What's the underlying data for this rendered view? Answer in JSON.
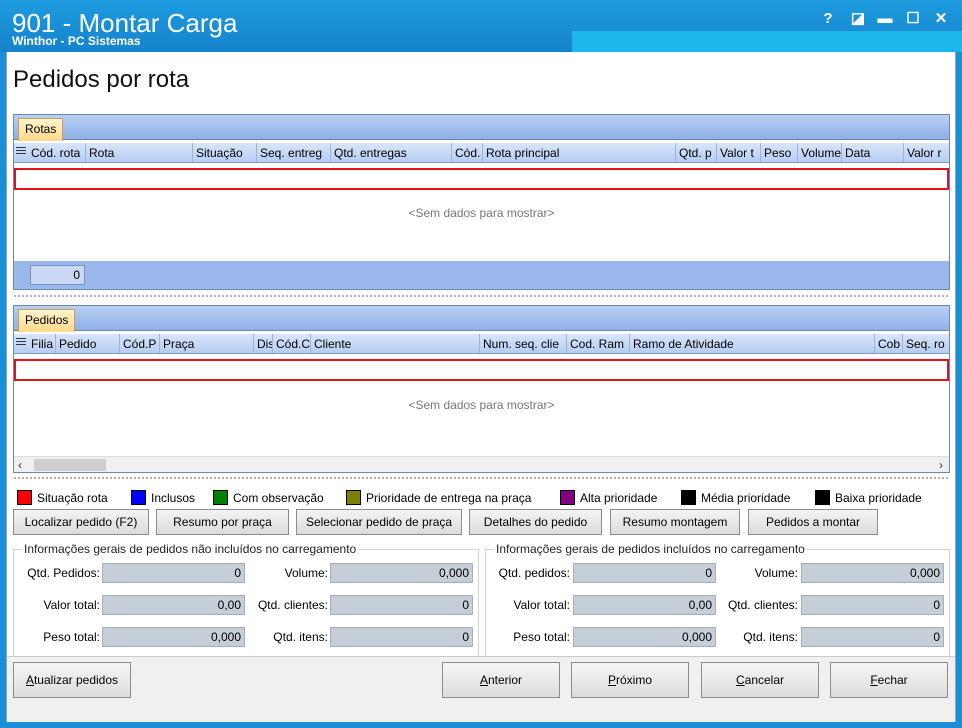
{
  "window": {
    "title": "901 - Montar Carga",
    "subtitle": "Winthor - PC Sistemas",
    "help": "?",
    "restore": "◪",
    "minimize": "▬",
    "maximize": "☐",
    "close": "✕"
  },
  "page": {
    "title": "Pedidos por rota"
  },
  "rotas": {
    "tab": "Rotas",
    "columns": [
      "Cód. rota",
      "Rota",
      "Situação",
      "Seq. entreg",
      "Qtd. entregas",
      "Cód.",
      "Rota principal",
      "Qtd. p",
      "Valor t",
      "Peso",
      "Volume",
      "Data",
      "Valor r"
    ],
    "empty": "<Sem dados para mostrar>",
    "footer_count": "0"
  },
  "pedidos": {
    "tab": "Pedidos",
    "columns": [
      "Filia",
      "Pedido",
      "Cód.P",
      "Praça",
      "Dis",
      "Cód.C",
      "Cliente",
      "Num. seq. clie",
      "Cod. Ram",
      "Ramo de Atividade",
      "Cob",
      "Seq. ro"
    ],
    "empty": "<Sem dados para mostrar>"
  },
  "legend": [
    {
      "label": "Situação rota",
      "color": "#ff0000"
    },
    {
      "label": "Inclusos",
      "color": "#0000ff"
    },
    {
      "label": "Com observação",
      "color": "#008000"
    },
    {
      "label": "Prioridade de entrega na praça",
      "color": "#808000"
    },
    {
      "label": "Alta prioridade",
      "color": "#800080"
    },
    {
      "label": "Média prioridade",
      "color": "#000000"
    },
    {
      "label": "Baixa prioridade",
      "color": "#000000"
    }
  ],
  "actions": {
    "localizar": "Localizar pedido (F2)",
    "resumo_praca": "Resumo por praça",
    "selecionar_praca": "Selecionar pedido de praça",
    "detalhes": "Detalhes do pedido",
    "resumo_montagem": "Resumo montagem",
    "pedidos_montar": "Pedidos a montar"
  },
  "nao_incluidos": {
    "title": "Informações gerais de pedidos não incluídos no carregamento",
    "qtd_pedidos_label": "Qtd. Pedidos:",
    "qtd_pedidos": "0",
    "valor_total_label": "Valor total:",
    "valor_total": "0,00",
    "peso_total_label": "Peso total:",
    "peso_total": "0,000",
    "volume_label": "Volume:",
    "volume": "0,000",
    "qtd_clientes_label": "Qtd. clientes:",
    "qtd_clientes": "0",
    "qtd_itens_label": "Qtd. itens:",
    "qtd_itens": "0"
  },
  "incluidos": {
    "title": "Informações gerais de pedidos incluídos no carregamento",
    "qtd_pedidos_label": "Qtd. pedidos:",
    "qtd_pedidos": "0",
    "valor_total_label": "Valor total:",
    "valor_total": "0,00",
    "peso_total_label": "Peso total:",
    "peso_total": "0,000",
    "volume_label": "Volume:",
    "volume": "0,000",
    "qtd_clientes_label": "Qtd. clientes:",
    "qtd_clientes": "0",
    "qtd_itens_label": "Qtd. itens:",
    "qtd_itens": "0"
  },
  "footer": {
    "atualizar": "Atualizar pedidos",
    "anterior": "Anterior",
    "proximo": "Próximo",
    "cancelar": "Cancelar",
    "fechar": "Fechar"
  }
}
